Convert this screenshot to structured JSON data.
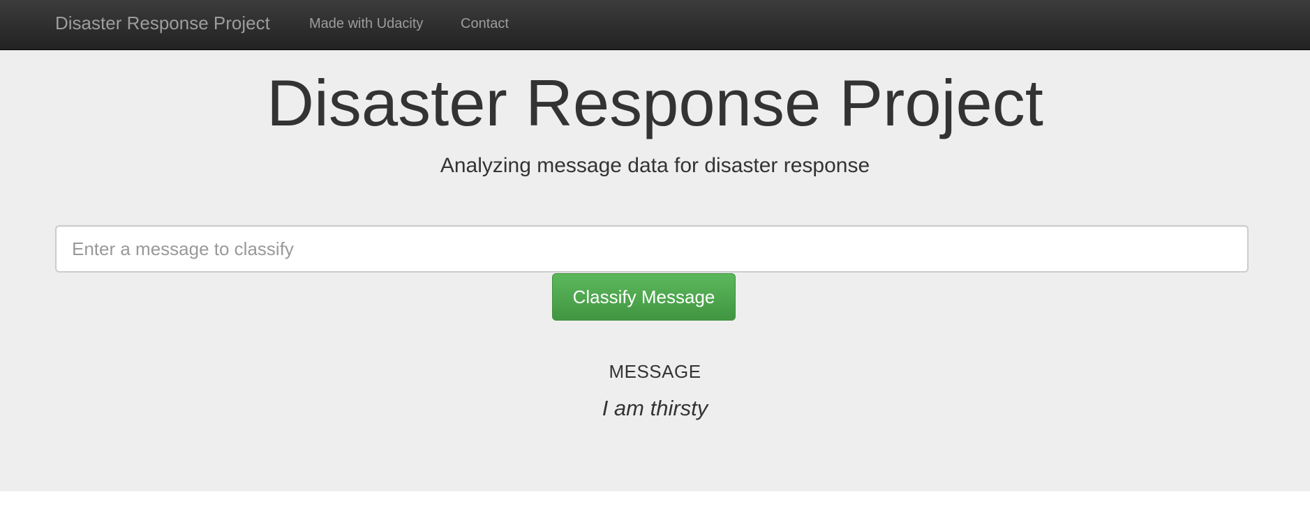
{
  "navbar": {
    "brand": "Disaster Response Project",
    "links": [
      {
        "label": "Made with Udacity"
      },
      {
        "label": "Contact"
      }
    ]
  },
  "hero": {
    "title": "Disaster Response Project",
    "subtitle": "Analyzing message data for disaster response"
  },
  "form": {
    "input_value": "",
    "input_placeholder": "Enter a message to classify",
    "submit_label": "Classify Message",
    "button_color": "#5cb85c"
  },
  "result": {
    "label": "MESSAGE",
    "message": "I am thirsty"
  }
}
